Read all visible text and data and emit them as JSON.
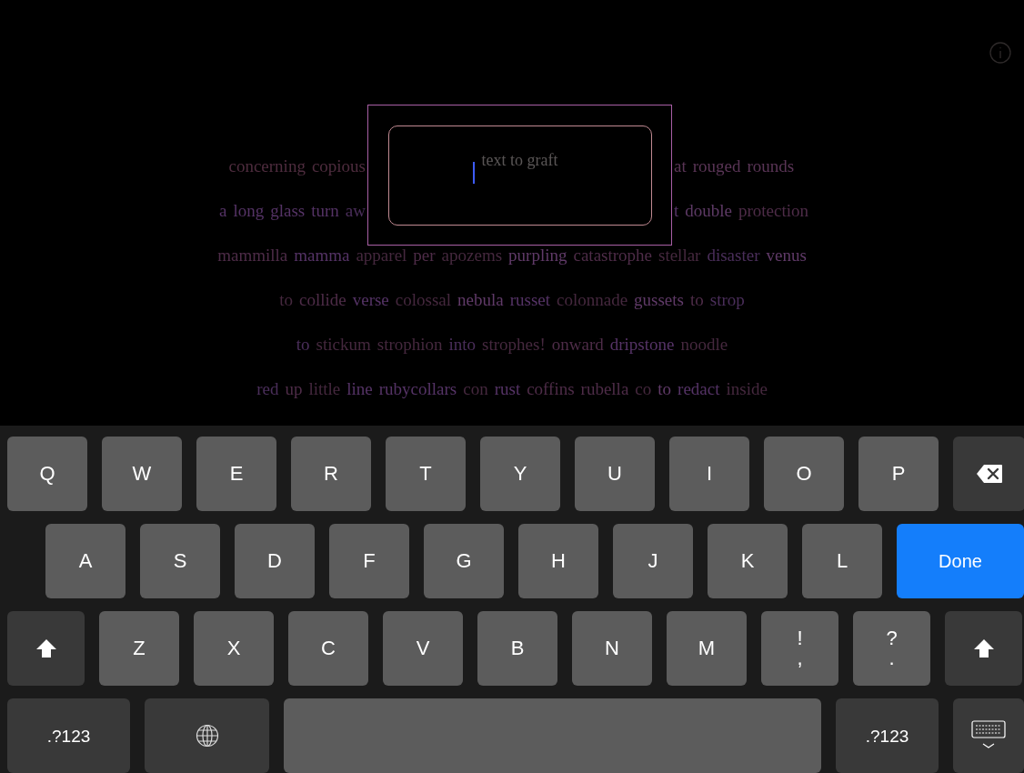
{
  "graft_field": {
    "placeholder": "text to graft"
  },
  "poem_lines": [
    {
      "segments": [
        [
          {
            "text": "concerning",
            "color": "#4e2c3e"
          },
          {
            "text": "copious",
            "color": "#4e2c3e"
          }
        ],
        [
          {
            "text": "at",
            "color": "#5a3556"
          },
          {
            "text": "rouged",
            "color": "#5a3556"
          },
          {
            "text": "rounds",
            "color": "#5a3556"
          }
        ]
      ]
    },
    {
      "segments": [
        [
          {
            "text": "a",
            "color": "#553366"
          },
          {
            "text": "long",
            "color": "#553366"
          },
          {
            "text": "glass",
            "color": "#553366"
          },
          {
            "text": "turn",
            "color": "#553366"
          },
          {
            "text": "aw",
            "color": "#4a2e5a"
          }
        ],
        [
          {
            "text": "t",
            "color": "#553366"
          },
          {
            "text": "double",
            "color": "#5e3a66"
          },
          {
            "text": "protection",
            "color": "#4e2c48"
          }
        ]
      ]
    },
    {
      "segments": [
        [
          {
            "text": "mammilla",
            "color": "#4e2c48"
          },
          {
            "text": "mamma",
            "color": "#553366"
          },
          {
            "text": "apparel",
            "color": "#45283e"
          },
          {
            "text": "per",
            "color": "#4e2c48"
          },
          {
            "text": "apozems",
            "color": "#45283e"
          },
          {
            "text": "purpling",
            "color": "#603a68"
          },
          {
            "text": "catastrophe",
            "color": "#4e2c48"
          },
          {
            "text": "stellar",
            "color": "#45283e"
          },
          {
            "text": "disaster",
            "color": "#4a2e5a"
          },
          {
            "text": "venus",
            "color": "#603a68"
          }
        ]
      ]
    },
    {
      "segments": [
        [
          {
            "text": "to",
            "color": "#45283e"
          },
          {
            "text": "collide",
            "color": "#4e2c48"
          },
          {
            "text": "verse",
            "color": "#553366"
          },
          {
            "text": "colossal",
            "color": "#45283e"
          },
          {
            "text": "nebula",
            "color": "#603a68"
          },
          {
            "text": "russet",
            "color": "#553366"
          },
          {
            "text": "colonnade",
            "color": "#45283e"
          },
          {
            "text": "gussets",
            "color": "#603a68"
          },
          {
            "text": "to",
            "color": "#4e2c48"
          },
          {
            "text": "strop",
            "color": "#4a2e5a"
          }
        ]
      ]
    },
    {
      "segments": [
        [
          {
            "text": "to",
            "color": "#4a2e5a"
          },
          {
            "text": "stickum",
            "color": "#45283e"
          },
          {
            "text": "strophion",
            "color": "#45283e"
          },
          {
            "text": "into",
            "color": "#4a2e5a"
          },
          {
            "text": "strophes!",
            "color": "#45283e"
          },
          {
            "text": "onward",
            "color": "#4e2c48"
          },
          {
            "text": "dripstone",
            "color": "#553366"
          },
          {
            "text": "noodle",
            "color": "#45283e"
          }
        ]
      ]
    },
    {
      "segments": [
        [
          {
            "text": "red",
            "color": "#4a2e5a"
          },
          {
            "text": "up",
            "color": "#4e2c48"
          },
          {
            "text": "little",
            "color": "#45283e"
          },
          {
            "text": "line",
            "color": "#553366"
          },
          {
            "text": "rubycollars",
            "color": "#553366"
          },
          {
            "text": "con",
            "color": "#45283e"
          },
          {
            "text": "rust",
            "color": "#553366"
          },
          {
            "text": "coffins",
            "color": "#4e2c48"
          },
          {
            "text": "rubella",
            "color": "#4e2c48"
          },
          {
            "text": "co",
            "color": "#45283e"
          },
          {
            "text": "to",
            "color": "#603a68"
          },
          {
            "text": "redact",
            "color": "#553366"
          },
          {
            "text": "inside",
            "color": "#45283e"
          }
        ]
      ]
    }
  ],
  "keyboard_rows": [
    [
      {
        "kind": "letter",
        "label": "Q"
      },
      {
        "kind": "letter",
        "label": "W"
      },
      {
        "kind": "letter",
        "label": "E"
      },
      {
        "kind": "letter",
        "label": "R"
      },
      {
        "kind": "letter",
        "label": "T"
      },
      {
        "kind": "letter",
        "label": "Y"
      },
      {
        "kind": "letter",
        "label": "U"
      },
      {
        "kind": "letter",
        "label": "I"
      },
      {
        "kind": "letter",
        "label": "O"
      },
      {
        "kind": "letter",
        "label": "P"
      },
      {
        "kind": "backspace"
      }
    ],
    [
      {
        "kind": "letter",
        "label": "A"
      },
      {
        "kind": "letter",
        "label": "S"
      },
      {
        "kind": "letter",
        "label": "D"
      },
      {
        "kind": "letter",
        "label": "F"
      },
      {
        "kind": "letter",
        "label": "G"
      },
      {
        "kind": "letter",
        "label": "H"
      },
      {
        "kind": "letter",
        "label": "J"
      },
      {
        "kind": "letter",
        "label": "K"
      },
      {
        "kind": "letter",
        "label": "L"
      },
      {
        "kind": "done",
        "label": "Done"
      }
    ],
    [
      {
        "kind": "shift"
      },
      {
        "kind": "letter",
        "label": "Z"
      },
      {
        "kind": "letter",
        "label": "X"
      },
      {
        "kind": "letter",
        "label": "C"
      },
      {
        "kind": "letter",
        "label": "V"
      },
      {
        "kind": "letter",
        "label": "B"
      },
      {
        "kind": "letter",
        "label": "N"
      },
      {
        "kind": "letter",
        "label": "M"
      },
      {
        "kind": "pair",
        "label": "!",
        "sub": ","
      },
      {
        "kind": "pair",
        "label": "?",
        "sub": "."
      },
      {
        "kind": "shift"
      }
    ],
    [
      {
        "kind": "mode",
        "label": ".?123"
      },
      {
        "kind": "globe"
      },
      {
        "kind": "space"
      },
      {
        "kind": "mode",
        "label": ".?123"
      },
      {
        "kind": "dismiss"
      }
    ]
  ]
}
